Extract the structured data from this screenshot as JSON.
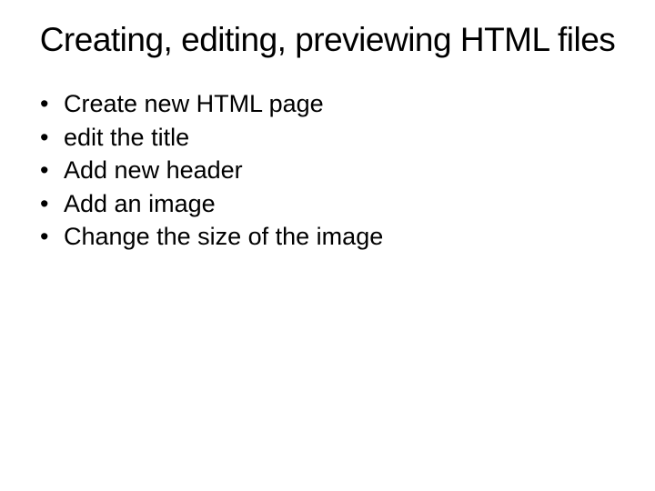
{
  "title": "Creating, editing, previewing HTML files",
  "bullets": [
    "Create new HTML page",
    " edit the title",
    "Add new header",
    "Add an image",
    "Change the size of the image"
  ]
}
